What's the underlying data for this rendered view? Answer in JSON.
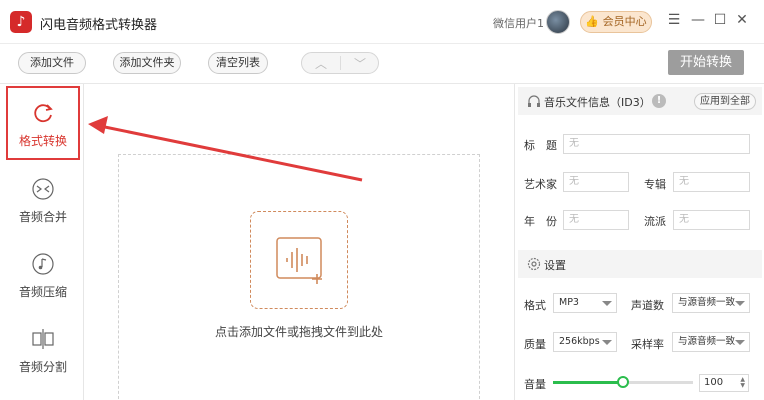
{
  "app": {
    "title": "闪电音频格式转换器",
    "logo_glyph": "♪",
    "user_name": "微信用户1",
    "vip_label": "会员中心"
  },
  "window": {
    "menu_glyph": "☰",
    "minimize_glyph": "—",
    "maximize_glyph": "☐",
    "close_glyph": "✕"
  },
  "toolbar": {
    "add_file": "添加文件",
    "add_folder": "添加文件夹",
    "clear_list": "清空列表",
    "nav_up": "︿",
    "nav_down": "﹀",
    "start": "开始转换"
  },
  "sidebar": {
    "items": [
      {
        "label": "格式转换",
        "active": true
      },
      {
        "label": "音频合并",
        "active": false
      },
      {
        "label": "音频压缩",
        "active": false
      },
      {
        "label": "音频分割",
        "active": false
      }
    ]
  },
  "dropzone": {
    "hint": "点击添加文件或拖拽文件到此处"
  },
  "id3": {
    "title": "音乐文件信息（ID3）",
    "info_glyph": "!",
    "apply_all": "应用到全部",
    "fields": {
      "title_label": "标　题",
      "title_placeholder": "无",
      "artist_label": "艺术家",
      "artist_placeholder": "无",
      "album_label": "专辑",
      "album_placeholder": "无",
      "year_label": "年　份",
      "year_placeholder": "无",
      "genre_label": "流派",
      "genre_placeholder": "无"
    }
  },
  "settings": {
    "title": "设置",
    "format_label": "格式",
    "format_value": "MP3",
    "channels_label": "声道数",
    "channels_value": "与源音频一致",
    "quality_label": "质量",
    "quality_value": "256kbps",
    "samplerate_label": "采样率",
    "samplerate_value": "与源音频一致",
    "volume_label": "音量",
    "volume_value": "100",
    "volume_fraction": 0.5
  },
  "colors": {
    "accent_red": "#e03b3b",
    "slider_green": "#2bbd4d",
    "start_button": "#9d9d9d",
    "vip_bg": "#fbe6cf"
  }
}
